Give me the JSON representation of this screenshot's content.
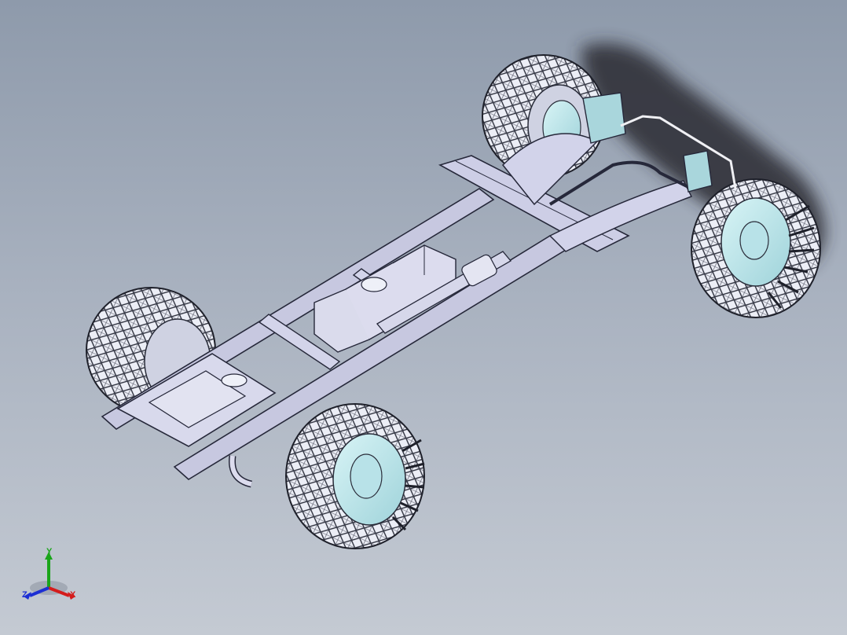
{
  "viewport": {
    "background_top": "#8e9aab",
    "background_bottom": "#c4cad3",
    "model": "truck-chassis-assembly"
  },
  "triad": {
    "x_label": "X",
    "y_label": "Y",
    "z_label": "Z",
    "x_color": "#d41c1c",
    "y_color": "#1aa51a",
    "z_color": "#1c2fd4"
  }
}
